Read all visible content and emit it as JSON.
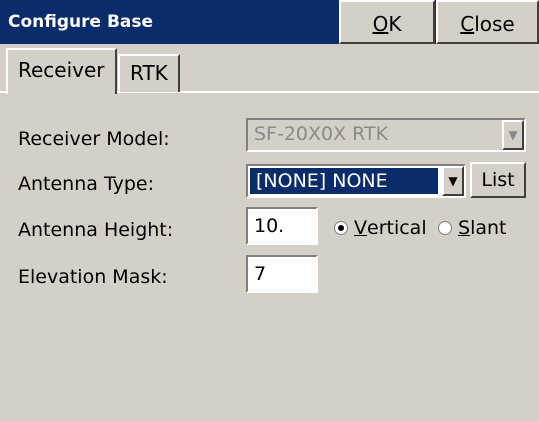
{
  "window": {
    "title": "Configure Base"
  },
  "titlebar": {
    "ok": {
      "underline": "O",
      "rest": "K"
    },
    "close": {
      "underline": "C",
      "rest": "lose"
    }
  },
  "tabs": [
    {
      "label": "Receiver",
      "active": true
    },
    {
      "label": "RTK",
      "active": false
    }
  ],
  "form": {
    "receiver_model": {
      "label": "Receiver Model:",
      "value": "SF-20X0X RTK"
    },
    "antenna_type": {
      "label": "Antenna Type:",
      "value": "[NONE] NONE",
      "list_button": "List"
    },
    "antenna_height": {
      "label": "Antenna Height:",
      "value": "10."
    },
    "height_mode": {
      "vertical": {
        "underline": "V",
        "rest": "ertical",
        "checked": true
      },
      "slant": {
        "underline": "S",
        "rest": "lant",
        "checked": false
      }
    },
    "elevation_mask": {
      "label": "Elevation Mask:",
      "value": "7"
    }
  }
}
